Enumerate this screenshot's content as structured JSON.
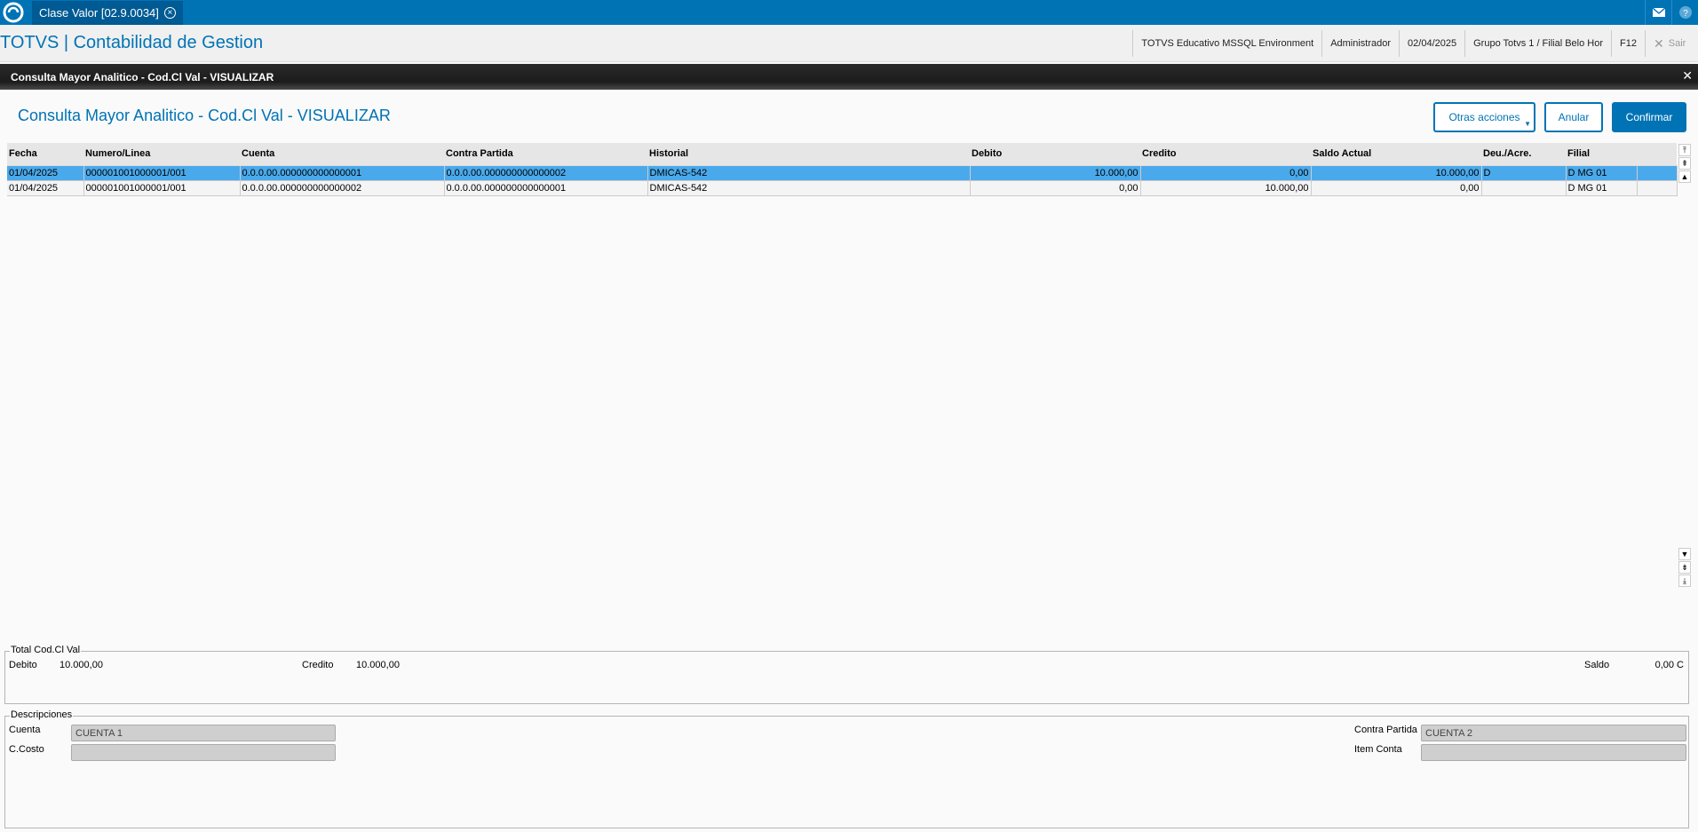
{
  "topbar": {
    "tab_label": "Clase Valor [02.9.0034]",
    "icons": [
      "totvs-logo-icon",
      "mail-icon",
      "help-icon"
    ]
  },
  "appbar": {
    "title": "TOTVS | Contabilidad de Gestion",
    "environment": "TOTVS Educativo MSSQL Environment",
    "user": "Administrador",
    "date": "02/04/2025",
    "branch": "Grupo Totvs 1 / Filial Belo Hor",
    "shortcut": "F12",
    "exit": "Sair"
  },
  "dialog": {
    "title": "Consulta Mayor Analitico - Cod.Cl Val - VISUALIZAR",
    "heading": "Consulta Mayor Analitico - Cod.Cl Val - VISUALIZAR"
  },
  "actions": {
    "other": "Otras acciones",
    "cancel": "Anular",
    "confirm": "Confirmar"
  },
  "grid": {
    "columns": [
      "Fecha",
      "Numero/Linea",
      "Cuenta",
      "Contra Partida",
      "Historial",
      "Debito",
      "Credito",
      "Saldo Actual",
      "Deu./Acre.",
      "Filial"
    ],
    "rows": [
      [
        "01/04/2025",
        "000001001000001/001",
        "0.0.0.00.000000000000001",
        "0.0.0.00.000000000000002",
        "DMICAS-542",
        "10.000,00",
        "0,00",
        "10.000,00",
        "D",
        "D MG 01"
      ],
      [
        "01/04/2025",
        "000001001000001/001",
        "0.0.0.00.000000000000002",
        "0.0.0.00.000000000000001",
        "DMICAS-542",
        "0,00",
        "10.000,00",
        "0,00",
        "",
        "D MG 01"
      ]
    ],
    "selected_row": 0
  },
  "totals": {
    "legend": "Total Cod.Cl Val",
    "debit_label": "Debito",
    "debit_value": "10.000,00",
    "credit_label": "Credito",
    "credit_value": "10.000,00",
    "balance_label": "Saldo",
    "balance_value": "0,00 C"
  },
  "descriptions": {
    "legend": "Descripciones",
    "account_label": "Cuenta",
    "account_value": "CUENTA 1",
    "cost_label": "C.Costo",
    "cost_value": "",
    "contra_label": "Contra Partida",
    "contra_value": "CUENTA 2",
    "item_label": "Item Conta",
    "item_value": ""
  },
  "colors": {
    "brand": "#0073b5",
    "selected_row": "#4aa9eb"
  }
}
